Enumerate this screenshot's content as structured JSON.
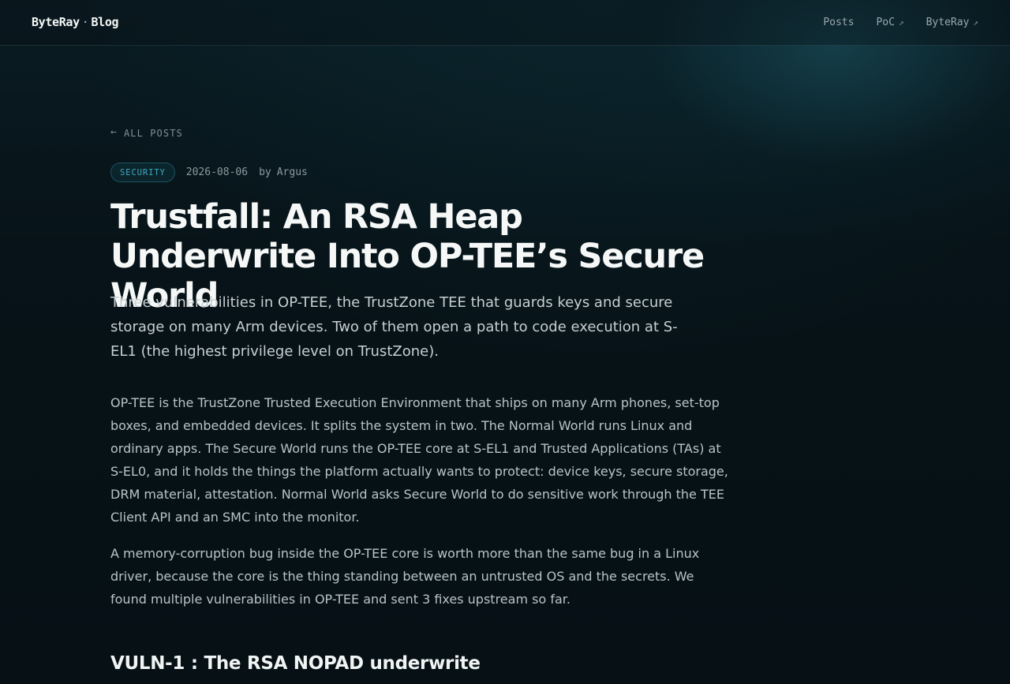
{
  "header": {
    "brand_primary": "ByteRay",
    "brand_separator": "·",
    "brand_secondary": "Blog",
    "nav": [
      {
        "label": "Posts"
      },
      {
        "label": "PoC",
        "icon": "external-link-icon",
        "glyph": "↗"
      },
      {
        "label": "ByteRay",
        "icon": "external-link-icon",
        "glyph": "↗"
      }
    ]
  },
  "article": {
    "back_label": "All posts",
    "back_icon": "arrow-left-icon",
    "back_glyph": "←",
    "category": "SECURITY",
    "date": "2026-08-06",
    "author_prefix": "by",
    "author": "Argus",
    "title": "Trustfall: An RSA Heap Underwrite Into OP-TEE’s Secure World",
    "dek": "Three vulnerabilities in OP-TEE, the TrustZone TEE that guards keys and secure storage on many Arm devices. Two of them open a path to code execution at S-EL1 (the highest privilege level on TrustZone).",
    "paragraphs": [
      "OP-TEE is the TrustZone Trusted Execution Environment that ships on many Arm phones, set-top boxes, and embedded devices. It splits the system in two. The Normal World runs Linux and ordinary apps. The Secure World runs the OP-TEE core at S-EL1 and Trusted Applications (TAs) at S-EL0, and it holds the things the platform actually wants to protect: device keys, secure storage, DRM material, attestation. Normal World asks Secure World to do sensitive work through the TEE Client API and an SMC into the monitor.",
      "A memory-corruption bug inside the OP-TEE core is worth more than the same bug in a Linux driver, because the core is the thing standing between an untrusted OS and the secrets. We found multiple vulnerabilities in OP-TEE and sent 3 fixes upstream so far."
    ],
    "section_heading": "VULN-1 : The RSA NOPAD underwrite"
  },
  "colors": {
    "background": "#071116",
    "accent": "#41a8c0",
    "title": "#f5f8f7",
    "body": "#b8c4c7",
    "muted": "#8b9a9f"
  }
}
